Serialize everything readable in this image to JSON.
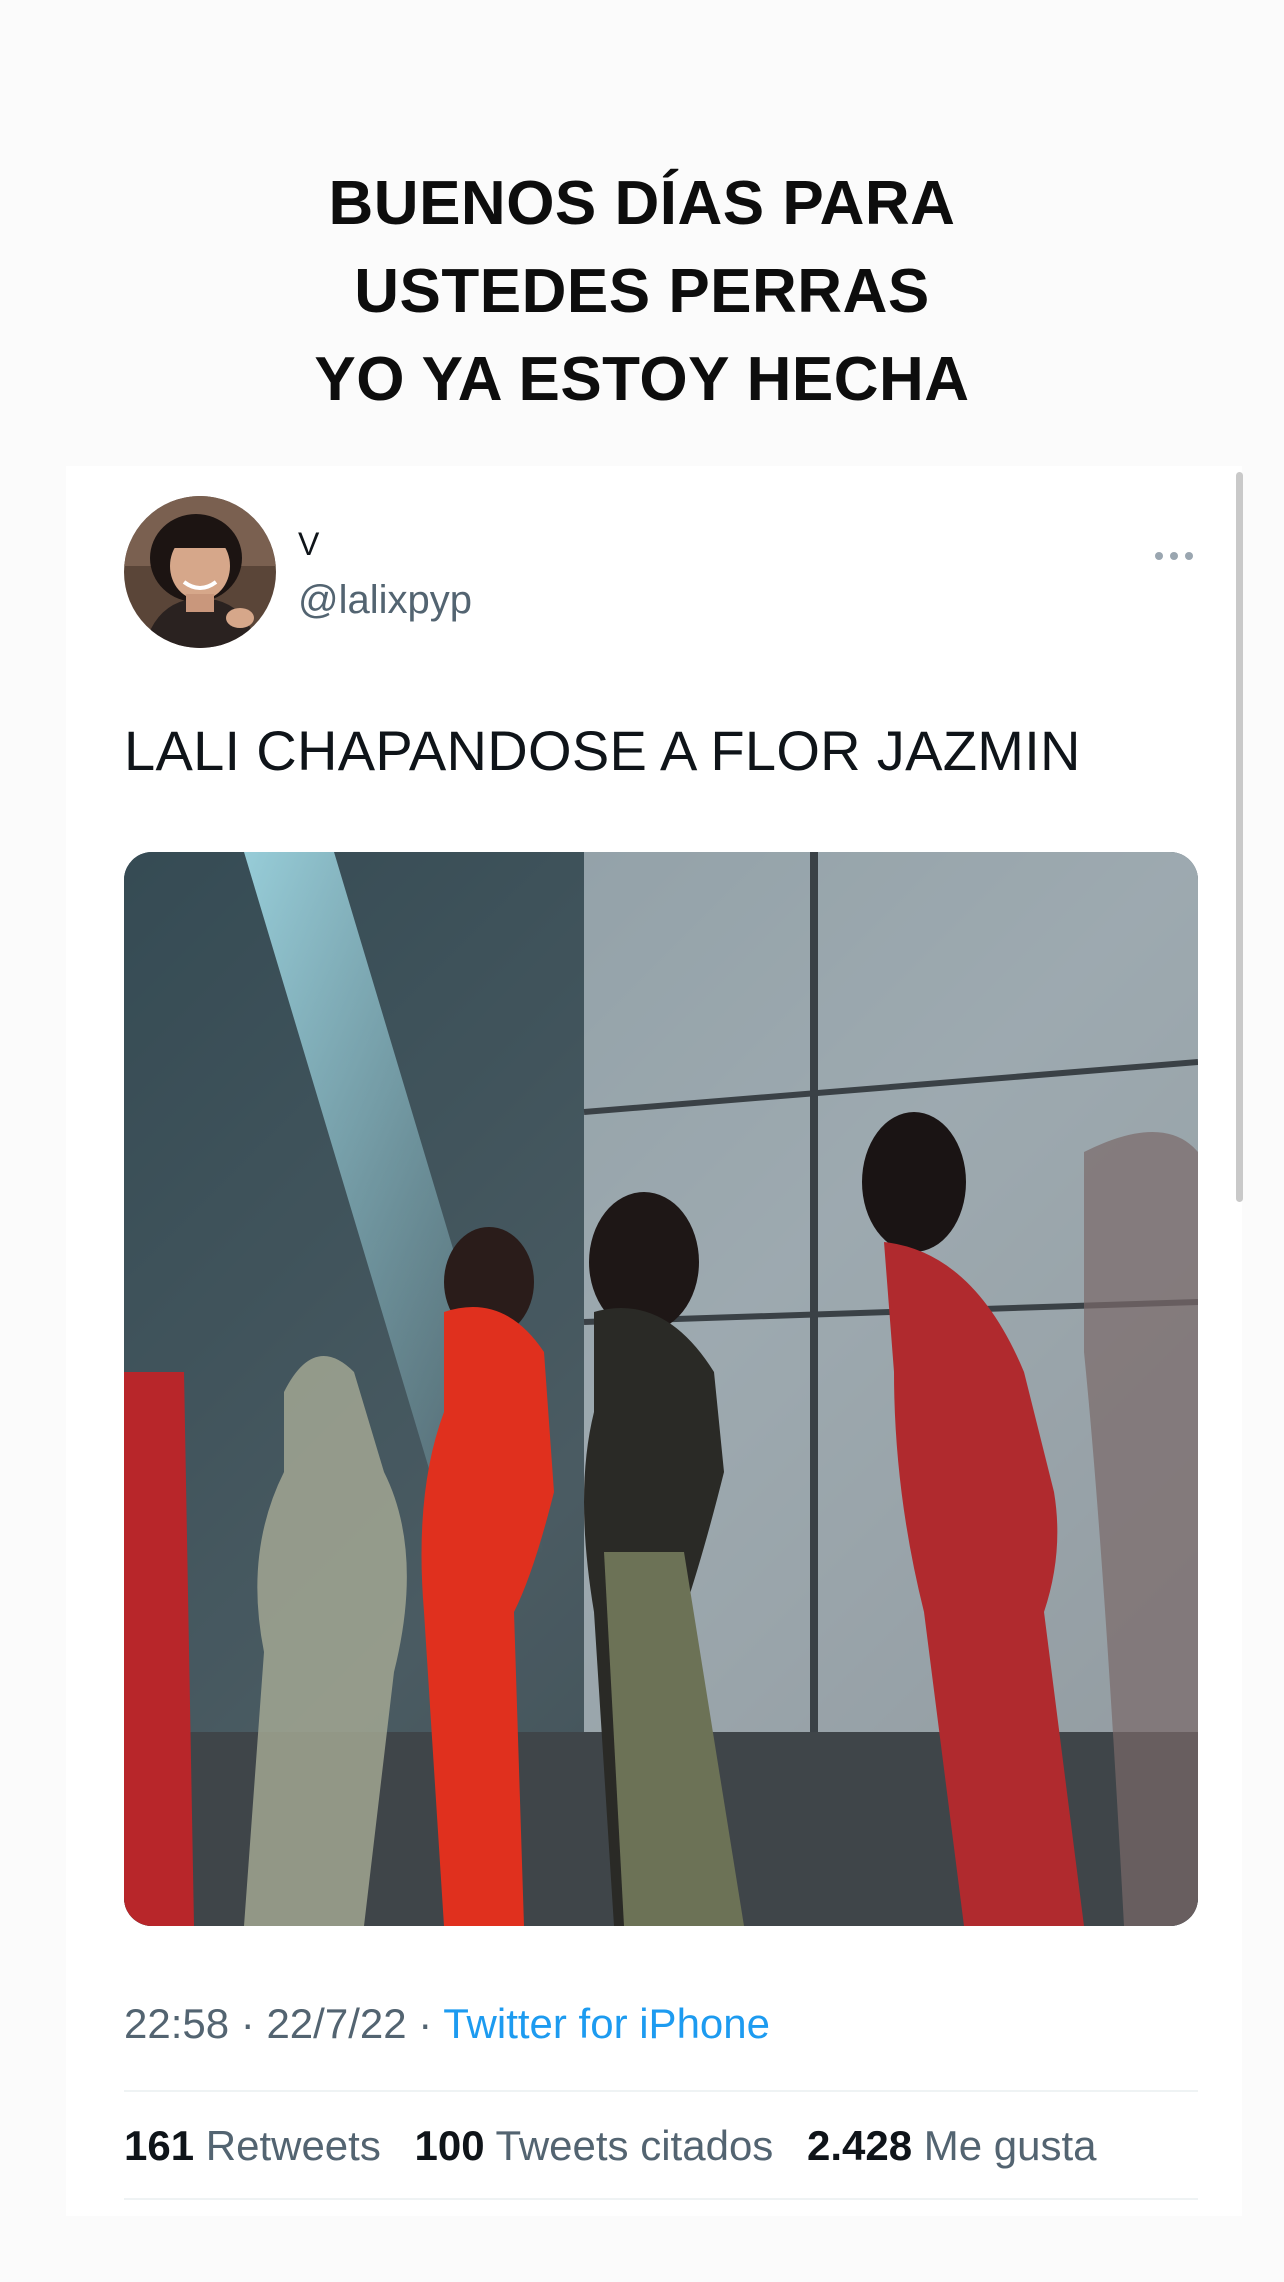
{
  "caption": {
    "lines": [
      "BUENOS DÍAS PARA",
      "USTEDES PERRAS",
      "YO YA ESTOY HECHA"
    ]
  },
  "tweet": {
    "display_name": "V",
    "handle": "@lalixpyp",
    "text": "LALI CHAPANDOSE A FLOR JAZMIN",
    "time": "22:58",
    "date": "22/7/22",
    "separator": "·",
    "source": "Twitter for iPhone",
    "more_icon": "more-horizontal-icon",
    "accent_color": "#1d9bf0",
    "stats": {
      "retweets_count": "161",
      "retweets_label": "Retweets",
      "quotes_count": "100",
      "quotes_label": "Tweets citados",
      "likes_count": "2.428",
      "likes_label": "Me gusta"
    }
  }
}
